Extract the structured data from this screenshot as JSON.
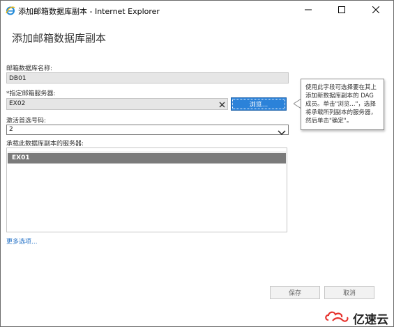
{
  "window": {
    "title": "添加邮箱数据库副本 - Internet Explorer"
  },
  "dialog": {
    "heading": "添加邮箱数据库副本",
    "db_name_label": "邮箱数据库名称:",
    "db_name_value": "DB01",
    "server_label": "*指定邮箱服务器:",
    "server_value": "EX02",
    "browse_label": "浏览...",
    "activation_label": "激活首选号码:",
    "activation_value": "2",
    "hosting_label": "承载此数据库副本的服务器:",
    "hosting_servers": [
      "EX01"
    ],
    "more_options": "更多选项...",
    "tooltip_lines": [
      "使用此字段可选择要在其上",
      "添加新数据库副本的 DAG",
      "成员。单击\"浏览...\"，选择",
      "将承载所列副本的服务器，",
      "然后单击\"确定\"。"
    ],
    "save_label": "保存",
    "cancel_label": "取消"
  },
  "watermark": {
    "text": "亿速云"
  },
  "colors": {
    "accent": "#2b82d9",
    "selected_row": "#7b7b7b",
    "link": "#2673c7",
    "watermark_red": "#e6322d"
  },
  "icons": [
    "ie-icon",
    "minimize-icon",
    "maximize-icon",
    "close-icon",
    "clear-icon",
    "chevron-down-icon",
    "cloud-logo-icon"
  ]
}
